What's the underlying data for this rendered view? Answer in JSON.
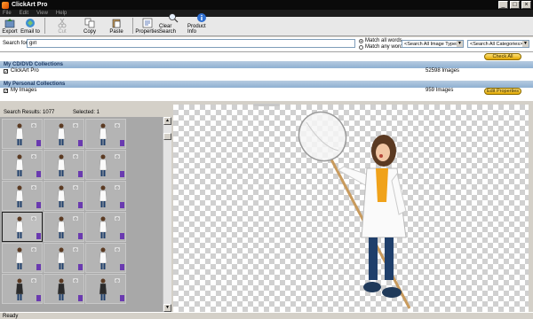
{
  "window": {
    "title": "ClickArt Pro"
  },
  "menu": [
    "File",
    "Edit",
    "View",
    "Help"
  ],
  "toolbar": [
    {
      "label": "Export",
      "icon": "export-icon",
      "enabled": true
    },
    {
      "label": "Email to",
      "icon": "email-icon",
      "enabled": true
    },
    {
      "label": "Cut",
      "icon": "cut-icon",
      "enabled": false
    },
    {
      "label": "Copy",
      "icon": "copy-icon",
      "enabled": true
    },
    {
      "label": "Paste",
      "icon": "paste-icon",
      "enabled": true
    },
    {
      "label": "Properties",
      "icon": "properties-icon",
      "enabled": true
    },
    {
      "label": "Clear Search",
      "icon": "clear-search-icon",
      "enabled": true
    },
    {
      "label": "Product Info",
      "icon": "info-icon",
      "enabled": true
    }
  ],
  "search": {
    "label": "Search for:",
    "value": "girl",
    "match_all": "Match all words",
    "match_any": "Match any word",
    "image_types": "<Search All Image Types>",
    "categories": "<Search All Categories>"
  },
  "collections": {
    "cd_header": "My CD/DVD Collections",
    "cd_item": {
      "name": "ClickArt Pro",
      "count": "52598 Images",
      "checked": true
    },
    "check_all": "Check All",
    "personal_header": "My Personal Collections",
    "personal_item": {
      "name": "My Images",
      "count": "959 Images",
      "checked": true
    },
    "edit_properties": "Edit Properties"
  },
  "results": {
    "search_results": "Search Results: 1077",
    "selected": "Selected: 1"
  },
  "status": "Ready",
  "colors": {
    "accent": "#e2a800",
    "header_blue": "#8fb0d2"
  }
}
